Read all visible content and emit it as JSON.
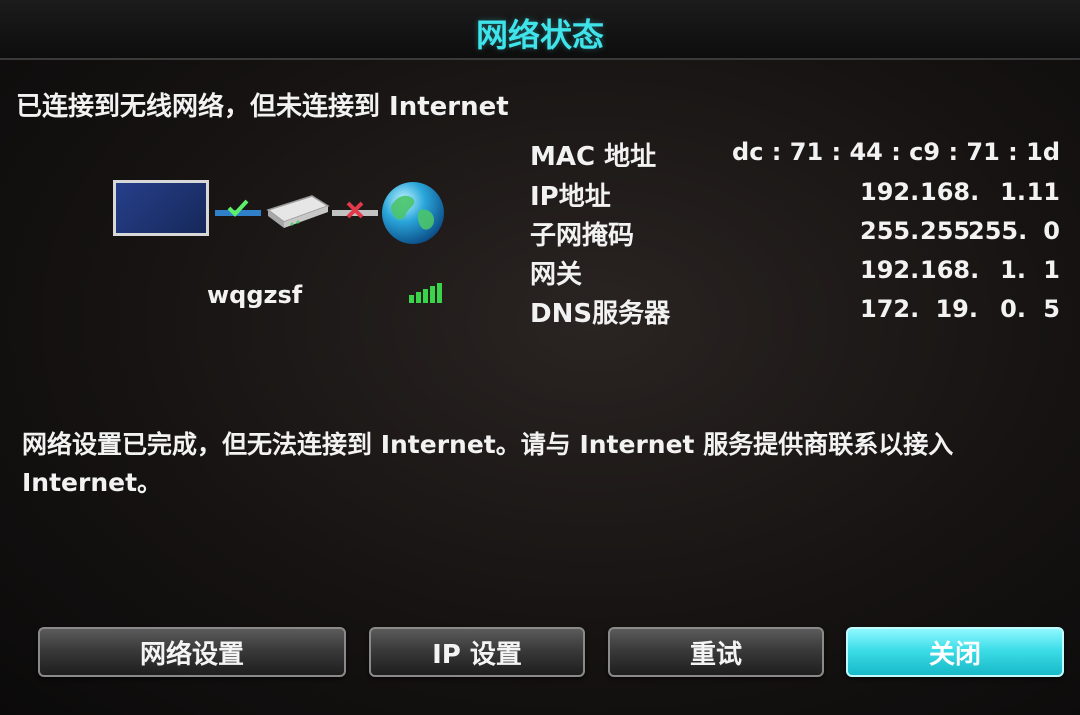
{
  "window": {
    "title": "网络状态"
  },
  "status": {
    "headline": "已连接到无线网络，但未连接到 Internet"
  },
  "diagram": {
    "ssid": "wqgzsf",
    "icons": [
      "tv-icon",
      "connected-check-icon",
      "router-icon",
      "disconnected-x-icon",
      "globe-icon",
      "signal-strength-icon"
    ]
  },
  "info": {
    "mac": {
      "label": "MAC 地址",
      "value": "dc : 71 : 44 : c9 : 71 : 1d"
    },
    "ip": {
      "label": "IP地址",
      "octets": [
        "192.",
        "168.",
        "1.",
        "11"
      ]
    },
    "subnet": {
      "label": "子网掩码",
      "octets": [
        "255.",
        "255.",
        "255.",
        "0"
      ]
    },
    "gateway": {
      "label": "网关",
      "octets": [
        "192.",
        "168.",
        "1.",
        "1"
      ]
    },
    "dns": {
      "label": "DNS服务器",
      "octets": [
        "172.",
        "19.",
        "0.",
        "5"
      ]
    }
  },
  "message": "网络设置已完成，但无法连接到 Internet。请与 Internet 服务提供商联系以接入 Internet。",
  "buttons": {
    "network_settings": "网络设置",
    "ip_settings": "IP 设置",
    "retry": "重试",
    "close": "关闭"
  },
  "colors": {
    "accent": "#3fe3ea",
    "ok": "#3ad44a",
    "error": "#e23a4a",
    "signal": "#3ad44a"
  }
}
